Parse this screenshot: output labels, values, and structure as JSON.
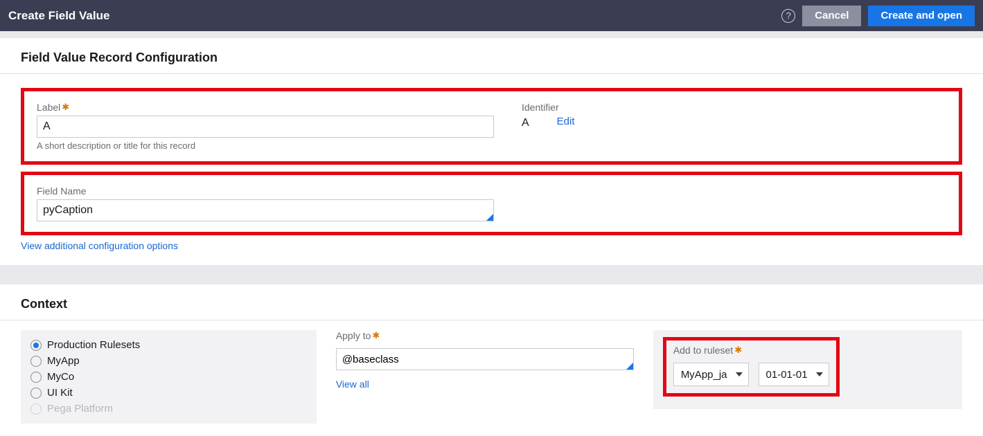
{
  "header": {
    "title": "Create Field Value",
    "cancel": "Cancel",
    "create_open": "Create and open",
    "help_icon_glyph": "?"
  },
  "config": {
    "section_title": "Field Value Record Configuration",
    "label_field": {
      "label": "Label",
      "value": "A",
      "helper": "A short description or title for this record"
    },
    "identifier": {
      "label": "Identifier",
      "value": "A",
      "edit_link": "Edit"
    },
    "field_name": {
      "label": "Field Name",
      "value": "pyCaption"
    },
    "view_additional": "View additional configuration options"
  },
  "context": {
    "section_title": "Context",
    "rulesets": [
      {
        "label": "Production Rulesets",
        "selected": true,
        "disabled": false
      },
      {
        "label": "MyApp",
        "selected": false,
        "disabled": false
      },
      {
        "label": "MyCo",
        "selected": false,
        "disabled": false
      },
      {
        "label": "UI Kit",
        "selected": false,
        "disabled": false
      },
      {
        "label": "Pega Platform",
        "selected": false,
        "disabled": true
      }
    ],
    "apply_to": {
      "label": "Apply to",
      "value": "@baseclass",
      "view_all": "View all"
    },
    "add_to_ruleset": {
      "label": "Add to ruleset",
      "ruleset_value": "MyApp_ja",
      "version_value": "01-01-01"
    }
  }
}
